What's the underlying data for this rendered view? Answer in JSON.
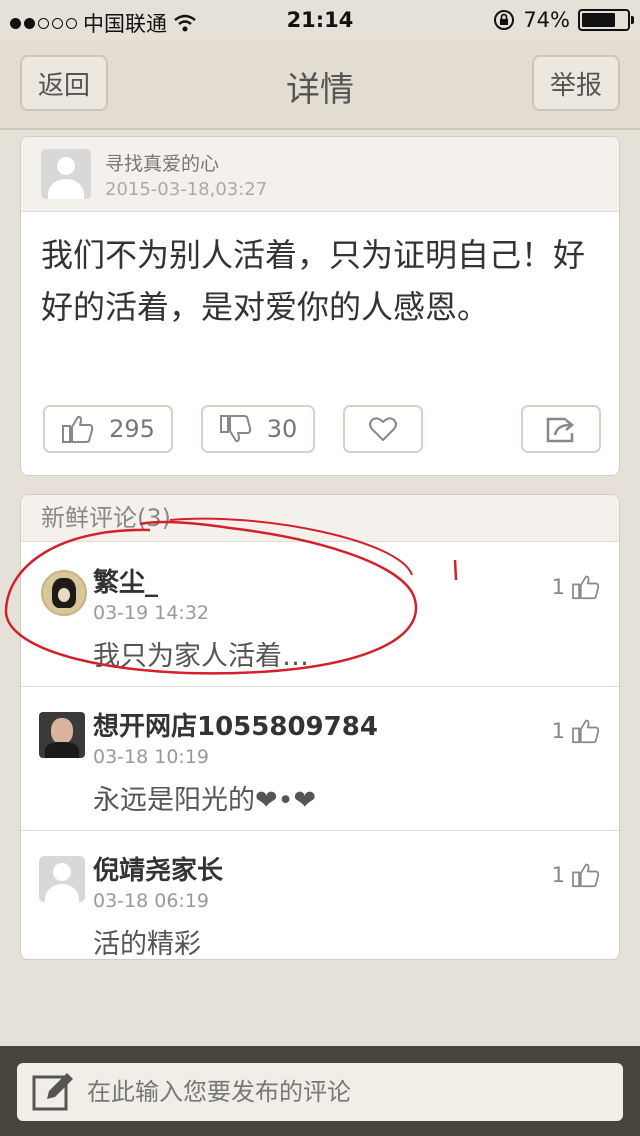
{
  "status_bar": {
    "carrier": "中国联通",
    "time": "21:14",
    "battery": "74%",
    "battery_level": 0.74
  },
  "nav": {
    "back": "返回",
    "title": "详情",
    "report": "举报"
  },
  "post": {
    "user": "寻找真爱的心",
    "time": "2015-03-18,03:27",
    "content": "我们不为别人活着，只为证明自己！好好的活着，是对爱你的人感恩。",
    "likes": "295",
    "dislikes": "30"
  },
  "comments": {
    "header": "新鲜评论(3)",
    "items": [
      {
        "name": "繁尘_",
        "time": "03-19 14:32",
        "text": "我只为家人活着…",
        "likes": "1"
      },
      {
        "name": "想开网店1055809784",
        "time": "03-18 10:19",
        "text": "永远是阳光的❤•❤",
        "likes": "1"
      },
      {
        "name": "倪靖尧家长",
        "time": "03-18 06:19",
        "text": "活的精彩",
        "likes": "1"
      }
    ]
  },
  "compose": {
    "placeholder": "在此输入您要发布的评论"
  }
}
